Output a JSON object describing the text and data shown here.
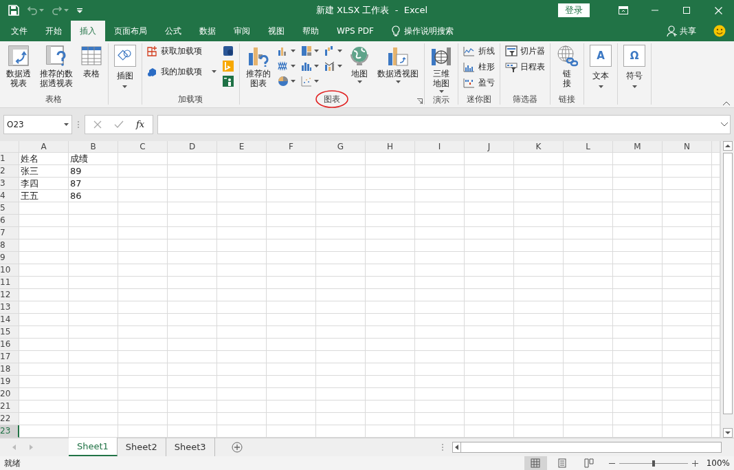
{
  "window": {
    "title": "新建 XLSX 工作表  -  Excel",
    "undo_enabled": false,
    "redo_enabled": false,
    "sign_in": "登录"
  },
  "tabs": [
    {
      "label": "文件",
      "selected": false
    },
    {
      "label": "开始",
      "selected": false
    },
    {
      "label": "插入",
      "selected": true
    },
    {
      "label": "页面布局",
      "selected": false
    },
    {
      "label": "公式",
      "selected": false
    },
    {
      "label": "数据",
      "selected": false
    },
    {
      "label": "审阅",
      "selected": false
    },
    {
      "label": "视图",
      "selected": false
    },
    {
      "label": "帮助",
      "selected": false
    },
    {
      "label": "WPS PDF",
      "selected": false
    }
  ],
  "tell_me": "操作说明搜索",
  "share": "共享",
  "ribbon": {
    "groups": [
      {
        "label": "表格",
        "columns": [
          [
            {
              "kind": "large",
              "label": "数据透视表",
              "wrapped": true,
              "menu": false
            }
          ],
          [
            {
              "kind": "large",
              "label": "推荐的数据透视表",
              "wrapped": true,
              "menu": false
            }
          ],
          [
            {
              "kind": "large",
              "label": "表格",
              "wrapped": false,
              "menu": false
            }
          ]
        ]
      },
      {
        "columns": [
          [
            {
              "kind": "boxed",
              "label": "插图",
              "menu": true
            }
          ]
        ]
      },
      {
        "label": "加载项",
        "columns": [
          [
            {
              "kind": "small",
              "label": "获取加载项",
              "menu": false
            },
            {
              "kind": "small",
              "label": "我的加载项",
              "menu": true
            }
          ],
          [
            {
              "kind": "icon",
              "menu": false
            },
            {
              "kind": "icon",
              "menu": false
            },
            {
              "kind": "icon",
              "menu": false
            }
          ]
        ]
      },
      {
        "label": "图表",
        "circled": true,
        "launcher": true,
        "columns": [
          [
            {
              "kind": "large",
              "label": "推荐的图表",
              "wrapped": true,
              "menu": false
            }
          ],
          [
            {
              "kind": "icon",
              "menu": true
            },
            {
              "kind": "icon",
              "menu": true
            },
            {
              "kind": "icon",
              "menu": true
            }
          ],
          [
            {
              "kind": "icon",
              "menu": true
            },
            {
              "kind": "icon",
              "menu": true
            },
            {
              "kind": "icon",
              "menu": true
            }
          ],
          [
            {
              "kind": "icon",
              "menu": true
            },
            {
              "kind": "icon",
              "menu": true
            }
          ],
          [
            {
              "kind": "large",
              "label": "地图",
              "wrapped": false,
              "menu": true
            }
          ],
          [
            {
              "kind": "large",
              "label": "数据透视图",
              "wrapped": false,
              "menu": true
            }
          ]
        ]
      },
      {
        "label": "演示",
        "columns": [
          [
            {
              "kind": "large",
              "label": "三维地图",
              "wrapped": true,
              "menu": true
            }
          ]
        ]
      },
      {
        "label": "迷你图",
        "columns": [
          [
            {
              "kind": "small",
              "label": "折线",
              "menu": false
            },
            {
              "kind": "small",
              "label": "柱形",
              "menu": false
            },
            {
              "kind": "small",
              "label": "盈亏",
              "menu": false
            }
          ]
        ]
      },
      {
        "label": "筛选器",
        "columns": [
          [
            {
              "kind": "small",
              "label": "切片器",
              "menu": false
            },
            {
              "kind": "small",
              "label": "日程表",
              "menu": false
            }
          ]
        ]
      },
      {
        "label": "链接",
        "columns": [
          [
            {
              "kind": "large",
              "label": "链接",
              "wrapped": true,
              "menu": false
            }
          ]
        ]
      },
      {
        "columns": [
          [
            {
              "kind": "boxed",
              "glyph": "A",
              "label": "文本",
              "menu": true
            }
          ]
        ]
      },
      {
        "columns": [
          [
            {
              "kind": "boxed",
              "glyph": "Ω",
              "label": "符号",
              "menu": true
            }
          ]
        ]
      }
    ]
  },
  "formula_bar": {
    "name_box": "O23",
    "fx": "fx"
  },
  "sheet": {
    "columns": [
      "A",
      "B",
      "C",
      "D",
      "E",
      "F",
      "G",
      "H",
      "I",
      "J",
      "K",
      "L",
      "M",
      "N"
    ],
    "rows": [
      {
        "number": "1",
        "selected": false,
        "cells": [
          "姓名",
          "成绩"
        ]
      },
      {
        "number": "2",
        "selected": false,
        "cells": [
          "张三",
          "89"
        ]
      },
      {
        "number": "3",
        "selected": false,
        "cells": [
          "李四",
          "87"
        ]
      },
      {
        "number": "4",
        "selected": false,
        "cells": [
          "王五",
          "86"
        ]
      },
      {
        "number": "5",
        "selected": false
      },
      {
        "number": "6",
        "selected": false
      },
      {
        "number": "7",
        "selected": false
      },
      {
        "number": "8",
        "selected": false
      },
      {
        "number": "9",
        "selected": false
      },
      {
        "number": "10",
        "selected": false
      },
      {
        "number": "11",
        "selected": false
      },
      {
        "number": "12",
        "selected": false
      },
      {
        "number": "13",
        "selected": false
      },
      {
        "number": "14",
        "selected": false
      },
      {
        "number": "15",
        "selected": false
      },
      {
        "number": "16",
        "selected": false
      },
      {
        "number": "17",
        "selected": false
      },
      {
        "number": "18",
        "selected": false
      },
      {
        "number": "19",
        "selected": false
      },
      {
        "number": "20",
        "selected": false
      },
      {
        "number": "21",
        "selected": false
      },
      {
        "number": "22",
        "selected": false
      },
      {
        "number": "23",
        "selected": true
      }
    ]
  },
  "sheet_tabs": [
    {
      "label": "Sheet1",
      "selected": true
    },
    {
      "label": "Sheet2",
      "selected": false
    },
    {
      "label": "Sheet3",
      "selected": false
    }
  ],
  "status_bar": {
    "text": "就绪",
    "views": [
      {
        "selected": true
      },
      {
        "selected": false
      },
      {
        "selected": false
      }
    ],
    "zoom": {
      "level": 0.5,
      "reading": "100%"
    }
  }
}
